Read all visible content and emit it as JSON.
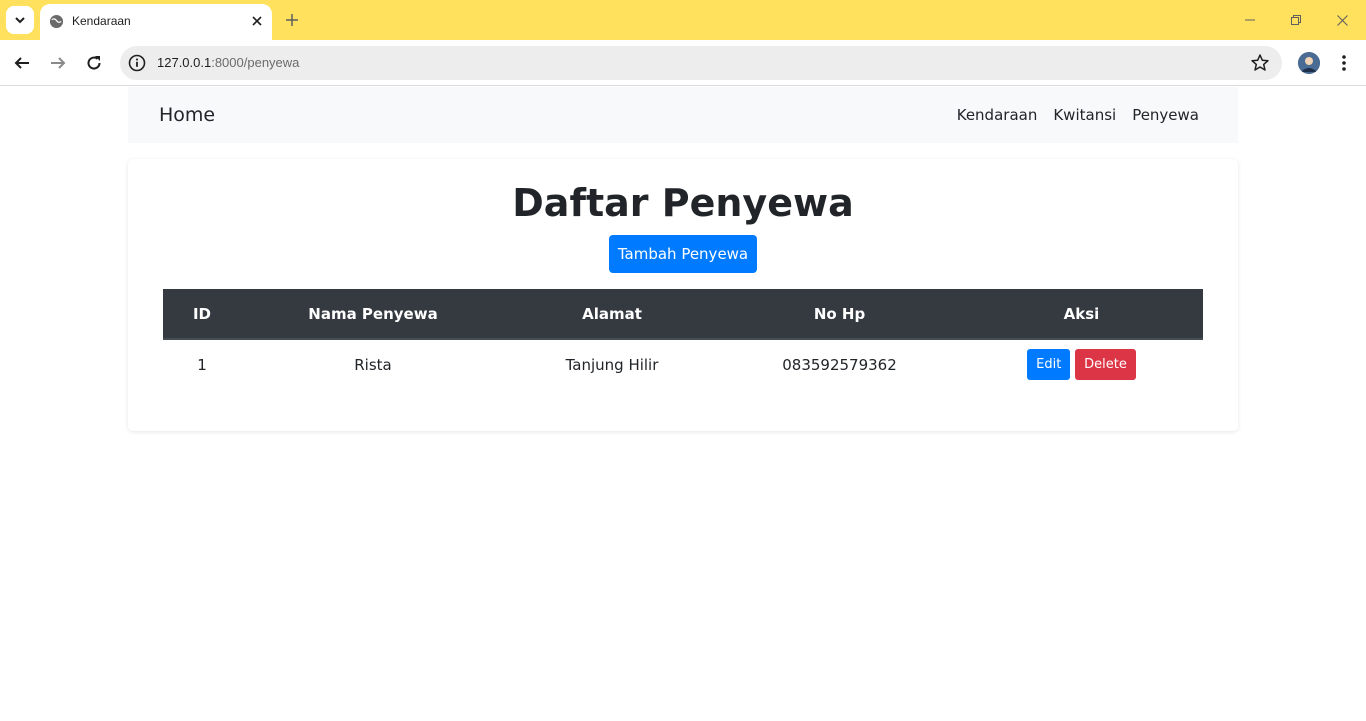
{
  "browser": {
    "tab_title": "Kendaraan",
    "url_host": "127.0.0.1",
    "url_rest": ":8000/penyewa",
    "accent_color": "#ffe15e"
  },
  "navbar": {
    "brand": "Home",
    "links": [
      "Kendaraan",
      "Kwitansi",
      "Penyewa"
    ]
  },
  "page": {
    "title": "Daftar Penyewa",
    "add_button": "Tambah Penyewa"
  },
  "table": {
    "headers": [
      "ID",
      "Nama Penyewa",
      "Alamat",
      "No Hp",
      "Aksi"
    ],
    "rows": [
      {
        "id": "1",
        "nama": "Rista",
        "alamat": "Tanjung Hilir",
        "no_hp": "083592579362",
        "edit_label": "Edit",
        "delete_label": "Delete"
      }
    ]
  },
  "colors": {
    "primary": "#007bff",
    "danger": "#dc3545",
    "table_header": "#343a40"
  }
}
